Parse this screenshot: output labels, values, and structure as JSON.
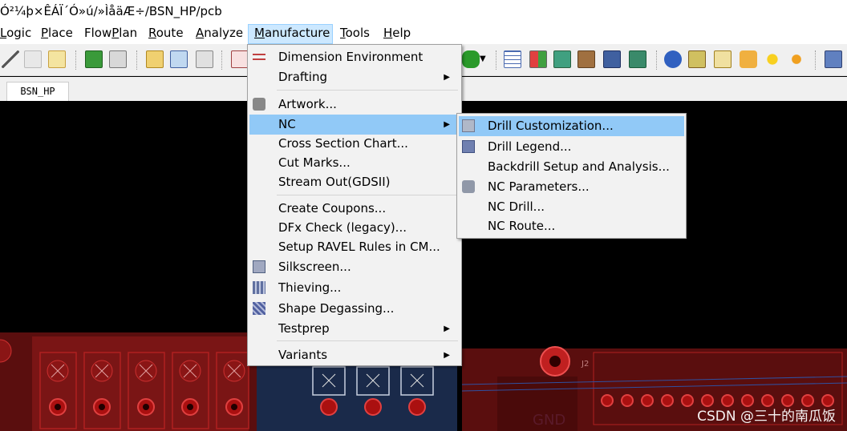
{
  "title": "Ó²¼þ×ÊÁÏ´Ó»ú/»ÌåäÆ÷/BSN_HP/pcb",
  "menubar": [
    {
      "label": "Logic",
      "u": 0
    },
    {
      "label": "Place",
      "u": 0
    },
    {
      "label": "FlowPlan",
      "u": 4
    },
    {
      "label": "Route",
      "u": 0
    },
    {
      "label": "Analyze",
      "u": 0
    },
    {
      "label": "Manufacture",
      "u": 0
    },
    {
      "label": "Tools",
      "u": 0
    },
    {
      "label": "Help",
      "u": 0
    }
  ],
  "tab": {
    "label": "BSN_HP"
  },
  "manufacture_menu": {
    "items": [
      {
        "label": "Dimension Environment",
        "icon": "dimension-icon",
        "submenu": false
      },
      {
        "label": "Drafting",
        "icon": "",
        "submenu": true
      },
      {
        "label": "Artwork...",
        "icon": "camera-icon",
        "submenu": false
      },
      {
        "label": "NC",
        "icon": "",
        "submenu": true
      },
      {
        "label": "Cross Section Chart...",
        "icon": "",
        "submenu": false
      },
      {
        "label": "Cut Marks...",
        "icon": "",
        "submenu": false
      },
      {
        "label": "Stream Out(GDSII)",
        "icon": "",
        "submenu": false
      },
      {
        "label": "Create Coupons...",
        "icon": "",
        "submenu": false
      },
      {
        "label": "DFx Check (legacy)...",
        "icon": "",
        "submenu": false
      },
      {
        "label": "Setup RAVEL Rules in CM...",
        "icon": "",
        "submenu": false
      },
      {
        "label": "Silkscreen...",
        "icon": "silkscreen-icon",
        "submenu": false
      },
      {
        "label": "Thieving...",
        "icon": "thieving-icon",
        "submenu": false
      },
      {
        "label": "Shape Degassing...",
        "icon": "degassing-icon",
        "submenu": false
      },
      {
        "label": "Testprep",
        "icon": "",
        "submenu": true
      },
      {
        "label": "Variants",
        "icon": "",
        "submenu": true
      }
    ]
  },
  "nc_submenu": {
    "items": [
      {
        "label": "Drill Customization...",
        "icon": "drill-customization-icon"
      },
      {
        "label": "Drill Legend...",
        "icon": "drill-legend-icon"
      },
      {
        "label": "Backdrill Setup and Analysis...",
        "icon": ""
      },
      {
        "label": "NC Parameters...",
        "icon": "nc-parameters-icon"
      },
      {
        "label": "NC Drill...",
        "icon": ""
      },
      {
        "label": "NC Route...",
        "icon": ""
      }
    ]
  },
  "pcb_labels": {
    "j2": "J2",
    "gnd": "GND"
  },
  "watermark": "CSDN @三十的南瓜饭",
  "colors": {
    "menu_highlight": "#91c9f7",
    "menubar_active": "#cce8ff",
    "pcb_red": "#8b1a1a",
    "pcb_bright": "#d42020"
  }
}
